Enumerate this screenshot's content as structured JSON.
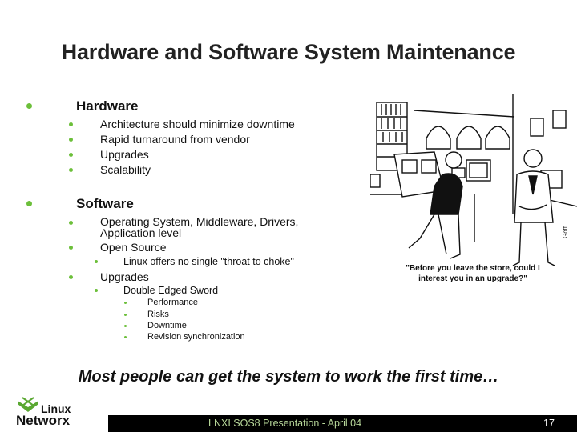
{
  "slide": {
    "title": "Hardware and Software System Maintenance",
    "sections": [
      {
        "label": "Hardware",
        "items": [
          {
            "text": "Architecture should minimize downtime"
          },
          {
            "text": "Rapid turnaround from vendor"
          },
          {
            "text": "Upgrades"
          },
          {
            "text": "Scalability"
          }
        ]
      },
      {
        "label": "Software",
        "items": [
          {
            "text": "Operating System, Middleware, Drivers,",
            "text2": "Application level"
          },
          {
            "text": "Open Source",
            "sub": [
              {
                "text": "Linux offers no single \"throat to choke\""
              }
            ]
          },
          {
            "text": "Upgrades",
            "sub": [
              {
                "text": "Double Edged Sword",
                "sub": [
                  {
                    "text": "Performance"
                  },
                  {
                    "text": "Risks"
                  },
                  {
                    "text": "Downtime"
                  },
                  {
                    "text": "Revision synchronization"
                  }
                ]
              }
            ]
          }
        ]
      }
    ],
    "tagline": "Most people can get the system to work the first time…",
    "cartoon": {
      "caption_line1": "\"Before you leave the store, could I",
      "caption_line2": "interest you in an upgrade?\"",
      "signature": "Goff"
    },
    "colors": {
      "bullet": "#6cbf3a",
      "footer_bg": "#000000",
      "footer_text": "#b8d89a",
      "logo_green": "#5aa832"
    }
  },
  "footer": {
    "logo_line1": "Linux",
    "logo_line2": "Networx",
    "presentation": "LNXI SOS8 Presentation - April 04",
    "page_number": "17"
  }
}
